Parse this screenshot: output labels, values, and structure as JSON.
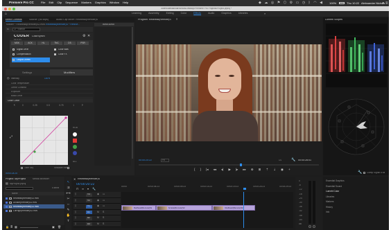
{
  "mac_menu": {
    "apple": "",
    "app_name": "Premiere Pro CC",
    "items": [
      "File",
      "Edit",
      "Clip",
      "Sequence",
      "Markers",
      "Graphics",
      "Window",
      "Help"
    ],
    "window_path": "/Users/aleksandarnichols/Desktop/Premiere Pro Projects/Project.prproj *",
    "battery": "100%",
    "datetime": "Thu 10:22",
    "user": "Aleksandar Nichols"
  },
  "workspaces": [
    "Learning",
    "Assembly",
    "Editing",
    "Color",
    "Effects",
    "Audio",
    "Graphics",
    "Libraries"
  ],
  "active_workspace": "Effects",
  "more_icon": "»",
  "effect_controls": {
    "tabs": [
      "Effect Controls",
      "Source: (no clips)",
      "Audio Clip Mixer: Redhead(Remote)S"
    ],
    "source_label": "Master * Redhead(Remote)S2.mov",
    "clip_label": "Redhead(Remote)S * RedSe...",
    "timecode": "00:00:20:00",
    "section_label": "CF VideoM",
    "plugin_logo": "CODER",
    "plugin_name": "ColorSync®",
    "plugin_version": "v1.0.0.0",
    "chip_row": [
      "MSK",
      "ACK",
      "HL",
      "TNC",
      "DS",
      "PSR"
    ],
    "checks": [
      {
        "label": "Signal Level",
        "on": false
      },
      {
        "label": "Color Bias",
        "on": true
      },
      {
        "label": "Compensation",
        "on": false
      },
      {
        "label": "Color FX",
        "on": true
      },
      {
        "label": "Output Levels",
        "on": false,
        "selected": true
      }
    ],
    "modes": [
      "Settings",
      "Modifiers"
    ],
    "active_mode": "Modifiers",
    "intensity_label": "Intensity",
    "intensity_value": "100%",
    "params": [
      "Color Temperature",
      "Linear Contrast",
      "Exposure",
      "Black Level"
    ],
    "curve_section": "Color Curve",
    "curve_ticks": [
      "0",
      "0.25",
      "0.5",
      "0.75",
      "1"
    ],
    "swatches": [
      "#ffffff",
      "#e53935",
      "#43a047",
      "#3949ab"
    ],
    "chips_right": [
      "RGB",
      "ALL"
    ],
    "tone_sep_label": "Tone Sep",
    "shoulder_label": "Shoulder Res",
    "footer_tc": "00:00:24:25"
  },
  "program": {
    "title": "Program: Redhead(Remote)S",
    "timecode": "00:00:20:22",
    "fit": "Fit",
    "resolution": "1/2",
    "duration": "00:00:28:01",
    "controls": [
      "mark-in-icon",
      "mark-out-icon",
      "step-back-icon",
      "go-in-icon",
      "prev-frame-icon",
      "play-icon",
      "next-frame-icon",
      "go-out-icon",
      "insert-icon",
      "overwrite-icon",
      "lift-icon",
      "extract-icon",
      "export-frame-icon",
      "button-editor-icon"
    ],
    "playhead_pos": 0.56
  },
  "lumetri_scopes": {
    "title": "Lumetri Scopes",
    "clamp_label": "Clamp Signal",
    "bit_depth": "8 Bit"
  },
  "right_list": {
    "items": [
      "Essential Graphics",
      "Essential Sound",
      "Lumetri Color",
      "Libraries",
      "Markers",
      "History",
      "Info"
    ],
    "active": "Lumetri Color"
  },
  "project": {
    "tabs": [
      "Project: MyProject",
      "Media Browser"
    ],
    "name": "MyProject.prproj",
    "count": "5 Items",
    "search_placeholder": "",
    "col_header": "Name",
    "items": [
      {
        "name": "Redhead(Remote)S2.mov",
        "color": "#4b72d6",
        "selected": false
      },
      {
        "name": "Arcade(Remote)S2.mov",
        "color": "#4b72d6",
        "selected": false
      },
      {
        "name": "Redhead(Remote)S2.mov",
        "color": "#4b72d6",
        "selected": true
      },
      {
        "name": "LutHigh(Remote)S2.mov",
        "color": "#4b72d6",
        "selected": false
      }
    ]
  },
  "timeline": {
    "tab": "Redhead(Remote)S",
    "timecode": "00:00:20:22",
    "ruler": [
      "00:00",
      "00:00:04:23",
      "00:00:09:23",
      "00:00:14:23",
      "00:00:19:23",
      "00:00:24:23",
      "00:00:29:23"
    ],
    "video_tracks": [
      "V3",
      "V2",
      "V1"
    ],
    "audio_tracks": [
      "A1",
      "A2",
      "A3"
    ],
    "playhead_pos": 0.71,
    "clips": [
      {
        "label": "Redhead(Remote)S2",
        "start": 0.0,
        "end": 0.2,
        "color": "#b6a3db"
      },
      {
        "label": "Arcade(Remote)S2",
        "start": 0.2,
        "end": 0.53,
        "color": "#b6a3db"
      },
      {
        "label": "Redhead(Remote)S2",
        "start": 0.53,
        "end": 0.78,
        "color": "#b6a3db"
      }
    ]
  },
  "tools": [
    "selection-tool-icon",
    "track-select-icon",
    "ripple-edit-icon",
    "razor-tool-icon",
    "slip-tool-icon",
    "pen-tool-icon",
    "hand-tool-icon",
    "type-tool-icon"
  ],
  "meter_labels": [
    "0",
    "-6",
    "-12",
    "-18",
    "-24",
    "-30",
    "-36",
    "-42",
    "-48",
    "-54",
    "dB"
  ],
  "colors": {
    "accent": "#2d8ceb",
    "panel": "#232323",
    "header": "#1a1a1a",
    "clip": "#b6a3db"
  }
}
